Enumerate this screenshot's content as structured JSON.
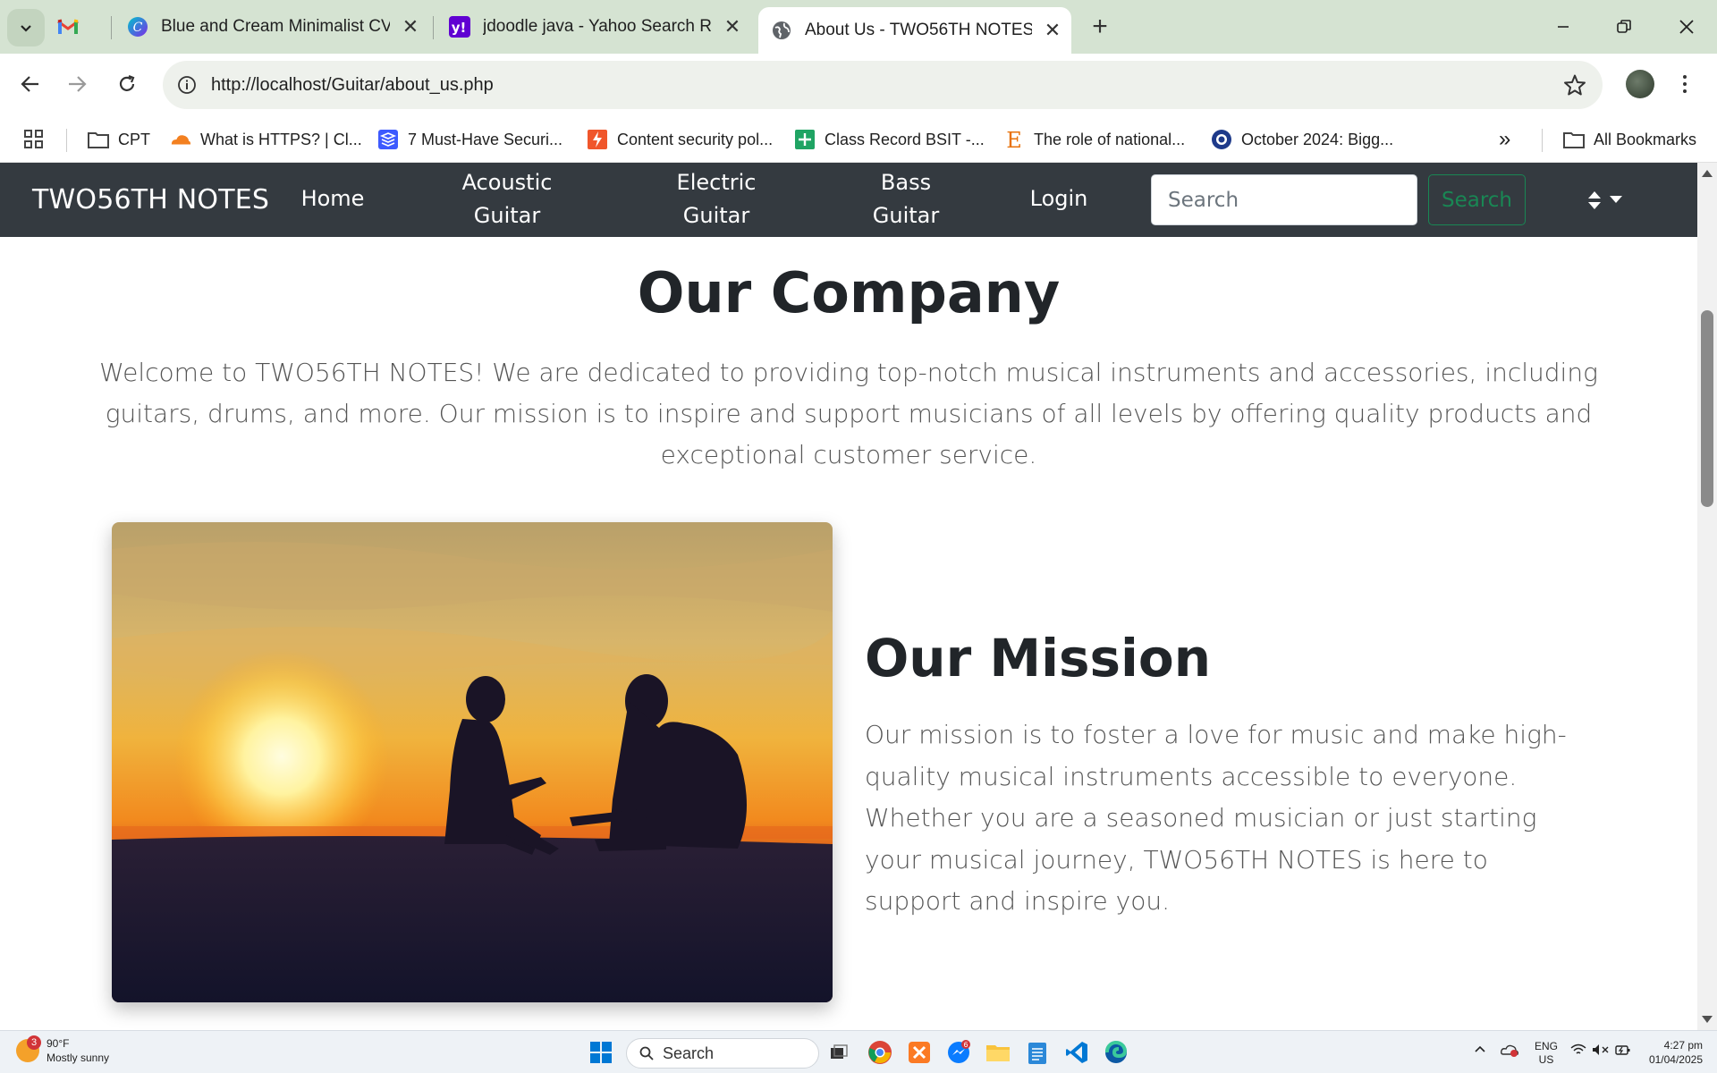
{
  "browser": {
    "tabs": [
      {
        "title": "",
        "favicon": "gmail-icon"
      },
      {
        "title": "Blue and Cream Minimalist CV R",
        "favicon": "canva-icon"
      },
      {
        "title": "jdoodle java - Yahoo Search Res",
        "favicon": "yahoo-icon"
      },
      {
        "title": "About Us - TWO56TH NOTES",
        "favicon": "globe-icon"
      }
    ],
    "url": "http://localhost/Guitar/about_us.php",
    "bookmarks": [
      {
        "label": "CPT",
        "icon": "folder-icon"
      },
      {
        "label": "What is HTTPS? | Cl...",
        "icon": "cloudflare-icon"
      },
      {
        "label": "7 Must-Have Securi...",
        "icon": "stack-icon"
      },
      {
        "label": "Content security pol...",
        "icon": "lightning-icon"
      },
      {
        "label": "Class Record BSIT -...",
        "icon": "sheets-icon"
      },
      {
        "label": "The role of national...",
        "icon": "letter-e-icon"
      },
      {
        "label": "October 2024: Bigg...",
        "icon": "eye-icon"
      }
    ],
    "all_bookmarks": "All Bookmarks",
    "more_bookmarks": "»"
  },
  "site": {
    "brand": "TWO56TH NOTES",
    "nav": [
      {
        "label": "Home"
      },
      {
        "label": "Acoustic Guitar"
      },
      {
        "label": "Electric Guitar"
      },
      {
        "label": "Bass Guitar"
      },
      {
        "label": "Login"
      }
    ],
    "search_placeholder": "Search",
    "search_button": "Search"
  },
  "content": {
    "company_heading": "Our Company",
    "company_text": "Welcome to TWO56TH NOTES! We are dedicated to providing top-notch musical instruments and accessories, including guitars, drums, and more. Our mission is to inspire and support musicians of all levels by offering quality products and exceptional customer service.",
    "mission_heading": "Our Mission",
    "mission_text": "Our mission is to foster a love for music and make high-quality musical instruments accessible to everyone. Whether you are a seasoned musician or just starting your musical journey, TWO56TH NOTES is here to support and inspire you."
  },
  "taskbar": {
    "weather_temp": "90°F",
    "weather_desc": "Mostly sunny",
    "weather_badge": "3",
    "search_label": "Search",
    "messenger_badge": "6",
    "lang_top": "ENG",
    "lang_bottom": "US",
    "time": "4:27 pm",
    "date": "01/04/2025"
  },
  "colors": {
    "navbar_bg": "#343a40",
    "search_btn": "#198754",
    "tabstrip_bg": "#d5e3d2"
  }
}
